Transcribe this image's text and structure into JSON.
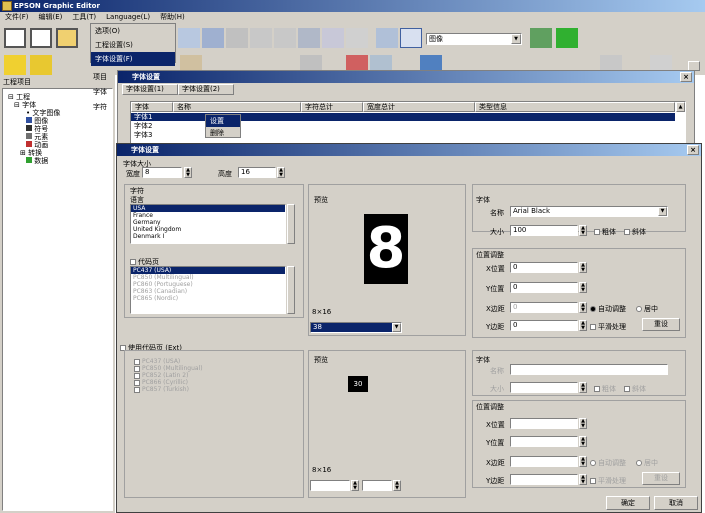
{
  "app": {
    "title": "EPSON Graphic Editor"
  },
  "menubar": [
    "文件(F)",
    "编辑(E)",
    "工具(T)",
    "Language(L)",
    "帮助(H)"
  ],
  "toolbar": {
    "mode_select": "图像"
  },
  "tools_menu": [
    "选项(O)",
    "工程设置(S)",
    "字体设置(F)"
  ],
  "side_panel": {
    "title": "工程项目",
    "tree": [
      "工程",
      "字体",
      "文字图像",
      "图像",
      "符号",
      "元素",
      "动画",
      "转换",
      "数据"
    ]
  },
  "context_menu": [
    "设置",
    "删除"
  ],
  "file_list_window": {
    "title": "字体设置",
    "side_labels": [
      "项目",
      "字体",
      "字符"
    ],
    "tabs": [
      "字体设置(1)",
      "字体设置(2)"
    ],
    "columns": [
      "字体",
      "名称",
      "字符总计",
      "宽度总计",
      "类型信息"
    ],
    "rows": [
      [
        "字体1",
        "",
        "",
        "",
        ""
      ],
      [
        "字体2",
        "",
        "",
        "",
        ""
      ],
      [
        "字体3",
        "",
        "",
        "",
        ""
      ]
    ]
  },
  "dialog": {
    "title": "字体设置",
    "font_size": {
      "label": "字体大小",
      "width_label": "宽度",
      "width_value": "8",
      "height_label": "高度",
      "height_value": "16"
    },
    "char_group": {
      "label": "字符",
      "lang_label": "语言",
      "languages": [
        "USA",
        "France",
        "Germany",
        "United Kingdom",
        "Denmark I"
      ],
      "codepage_check": "代码页",
      "codepages": [
        "PC437 (USA)",
        "PC850 (Multilingual)",
        "PC860 (Portuguese)",
        "PC863 (Canadian)",
        "PC865 (Nordic)"
      ]
    },
    "preview": {
      "label": "预览",
      "char": "8",
      "size_text": "8×16",
      "select_value": "38"
    },
    "font_panel": {
      "label": "字体",
      "name_label": "名称",
      "name_value": "Arial Black",
      "size_label": "大小",
      "size_value": "100",
      "bold_label": "粗体",
      "italic_label": "斜体"
    },
    "adjust_panel": {
      "label": "位置调整",
      "rows": [
        {
          "label": "X位置",
          "value": "0"
        },
        {
          "label": "Y位置",
          "value": "0"
        },
        {
          "label": "X边距",
          "value": "0"
        },
        {
          "label": "Y边距",
          "value": "0"
        }
      ],
      "auto_label": "自动调整",
      "center_label": "居中",
      "smooth_label": "平滑处理",
      "reset_label": "重设"
    },
    "check2": "使用代码页 (Ext)",
    "list2": [
      "PC437 (USA)",
      "PC850 (Multilingual)",
      "PC852 (Latin 2)",
      "PC866 (Cyrillic)",
      "PC857 (Turkish)"
    ],
    "preview2": {
      "label": "预览",
      "char": "30",
      "size_text": "8×16"
    },
    "font_panel2": {
      "label": "字体",
      "name_label": "名称",
      "name_value": "",
      "size_label": "大小",
      "size_value": ""
    },
    "adjust_panel2": {
      "label": "位置调整",
      "rows": [
        "X位置",
        "Y位置",
        "X边距",
        "Y边距"
      ]
    },
    "ok_label": "确定",
    "cancel_label": "取消"
  }
}
